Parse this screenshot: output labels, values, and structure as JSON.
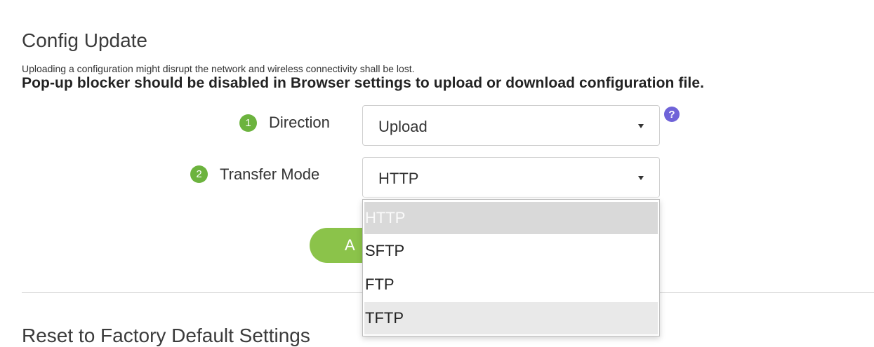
{
  "section": {
    "title": "Config Update",
    "description": "Uploading a configuration might disrupt the network and wireless connectivity shall be lost.",
    "warning": "Pop-up blocker should be disabled in Browser settings to upload or download configuration file."
  },
  "form": {
    "direction": {
      "step": "1",
      "label": "Direction",
      "value": "Upload",
      "help_icon": "?"
    },
    "transfer_mode": {
      "step": "2",
      "label": "Transfer Mode",
      "value": "HTTP"
    },
    "apply_label": "A"
  },
  "dropdown": {
    "options": [
      "HTTP",
      "SFTP",
      "FTP",
      "TFTP"
    ],
    "selected": "HTTP",
    "hovered": "TFTP"
  },
  "reset": {
    "title": "Reset to Factory Default Settings"
  },
  "colors": {
    "step_badge": "#6cb33e",
    "apply_button": "#8bc34a",
    "help_icon": "#6f63d8"
  }
}
